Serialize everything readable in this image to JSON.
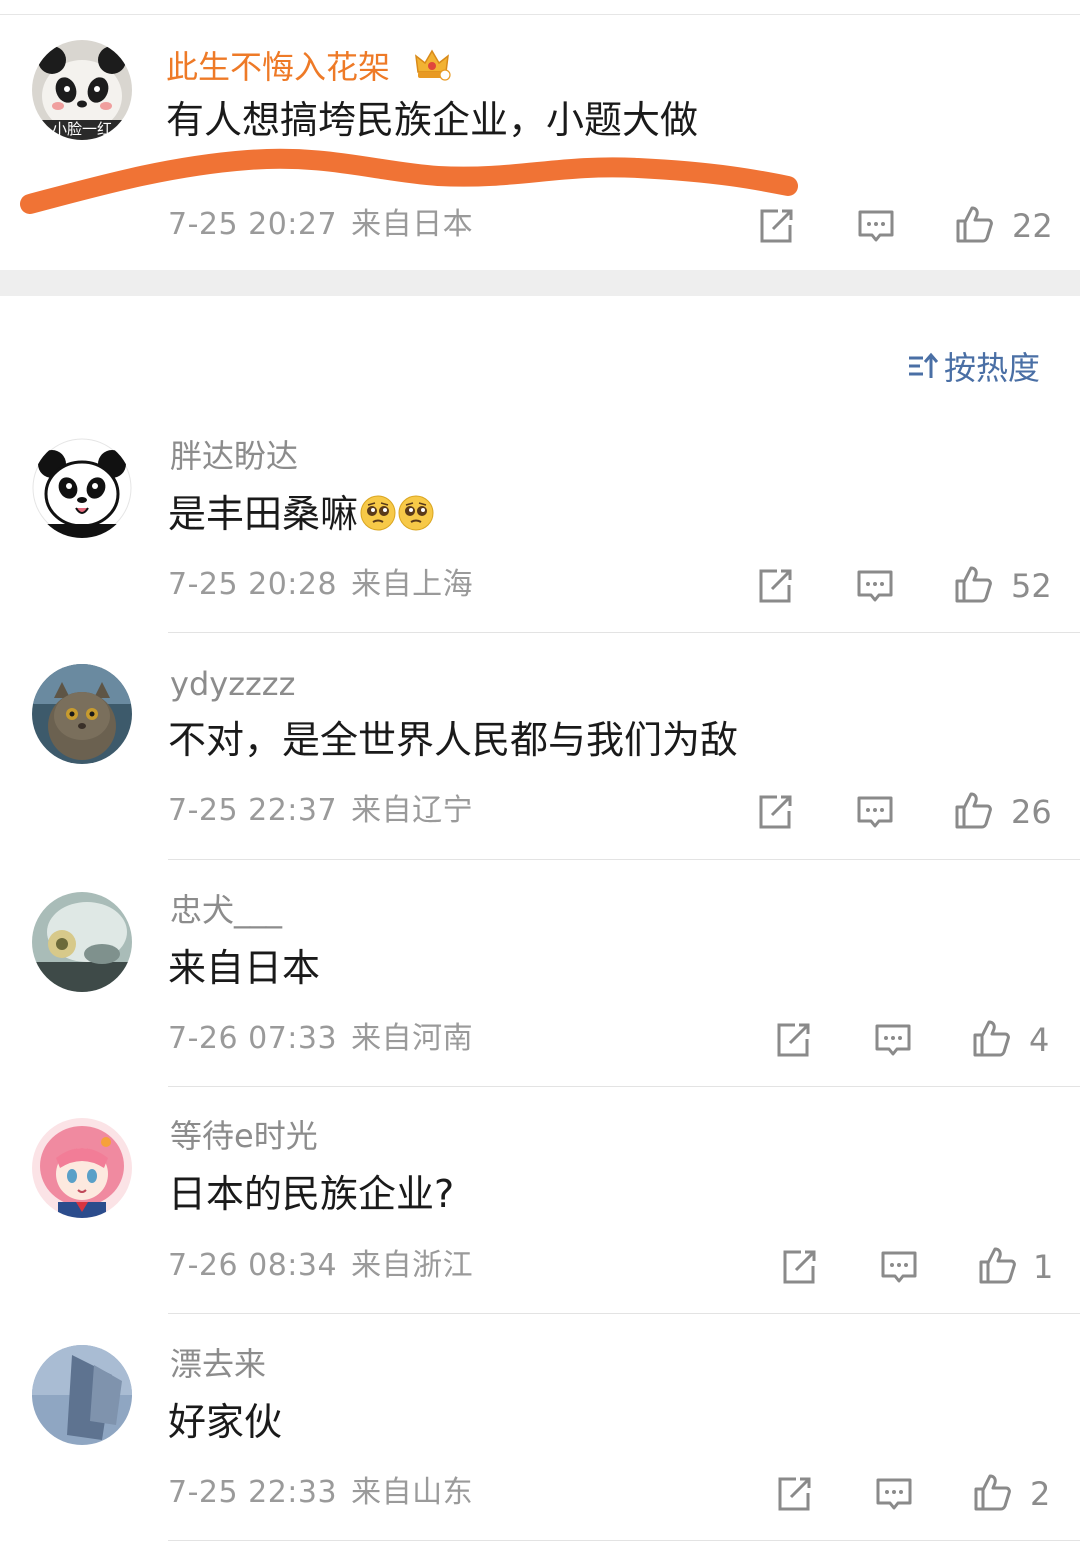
{
  "top_comment": {
    "user_name": "此生不悔入花架",
    "avatar_caption": "小脸一红",
    "content": "有人想搞垮民族企业，小题大做",
    "time": "7-25 20:27",
    "location": "来自日本",
    "likes": "22",
    "name_color": "#ee7a27",
    "highlight_stroke_color": "#f07335"
  },
  "sort": {
    "label": "按热度",
    "color": "#4a6fa5"
  },
  "replies": [
    {
      "user_name": "胖达盼达",
      "content": "是丰田桑嘛",
      "emoji_count": 2,
      "time": "7-25 20:28",
      "location": "来自上海",
      "likes": "52"
    },
    {
      "user_name": "ydyzzzz",
      "content": "不对，是全世界人民都与我们为敌",
      "time": "7-25 22:37",
      "location": "来自辽宁",
      "likes": "26"
    },
    {
      "user_name": "忠犬___",
      "content": "来自日本",
      "time": "7-26 07:33",
      "location": "来自河南",
      "likes": "4"
    },
    {
      "user_name": "等待e时光",
      "content": "日本的民族企业?",
      "time": "7-26 08:34",
      "location": "来自浙江",
      "likes": "1"
    },
    {
      "user_name": "漂去来",
      "content": "好家伙",
      "time": "7-25 22:33",
      "location": "来自山东",
      "likes": "2"
    }
  ],
  "icons": {
    "share": "share-icon",
    "comment": "comment-icon",
    "like": "thumbs-up-icon",
    "sort": "sort-icon",
    "crown": "crown-badge-icon",
    "emoji": "pleading-face-emoji"
  }
}
